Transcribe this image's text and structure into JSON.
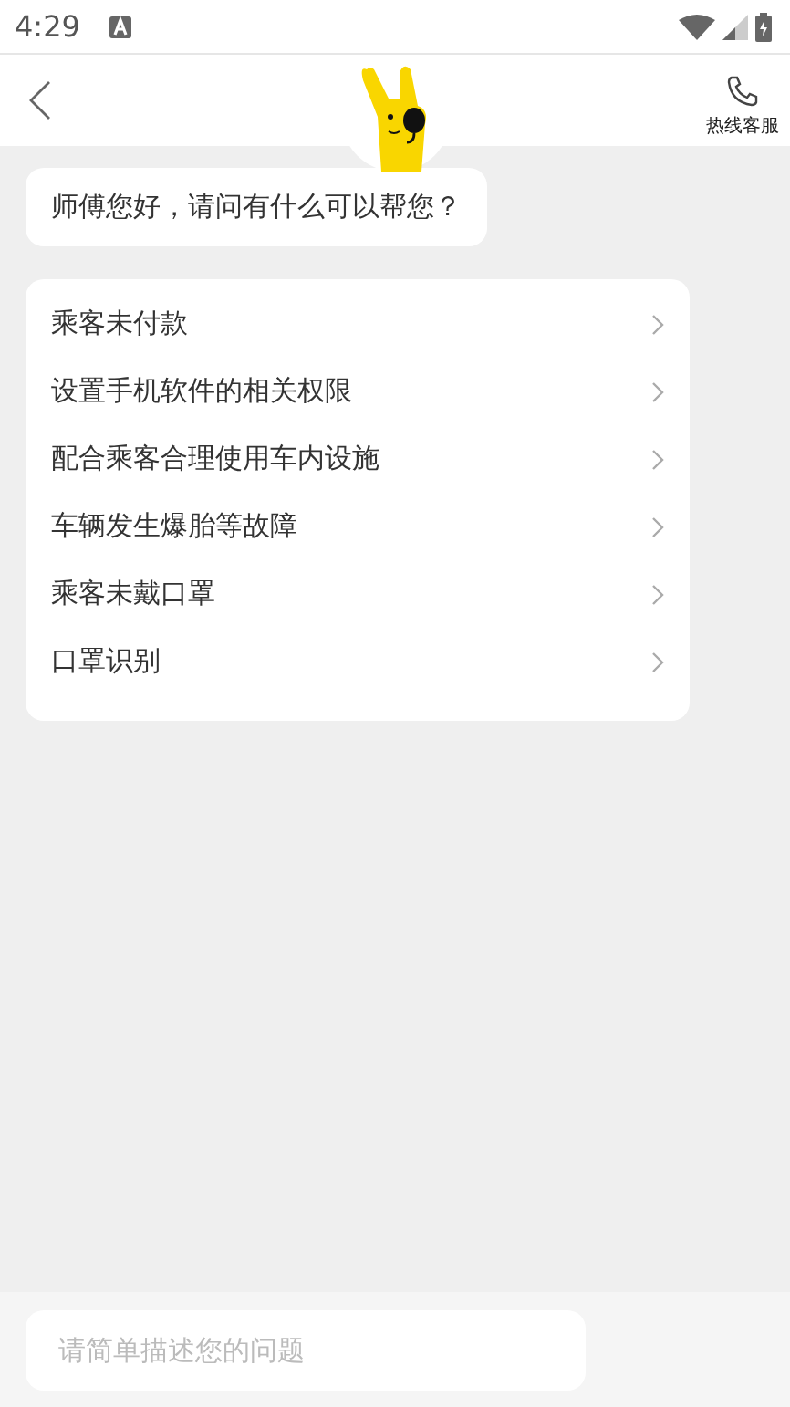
{
  "status_bar": {
    "time": "4:29"
  },
  "header": {
    "hotline_label": "热线客服"
  },
  "greeting": "师傅您好，请问有什么可以帮您？",
  "questions": [
    {
      "label": "乘客未付款"
    },
    {
      "label": "设置手机软件的相关权限"
    },
    {
      "label": "配合乘客合理使用车内设施"
    },
    {
      "label": "车辆发生爆胎等故障"
    },
    {
      "label": "乘客未戴口罩"
    },
    {
      "label": "口罩识别"
    }
  ],
  "input": {
    "placeholder": "请简单描述您的问题"
  }
}
